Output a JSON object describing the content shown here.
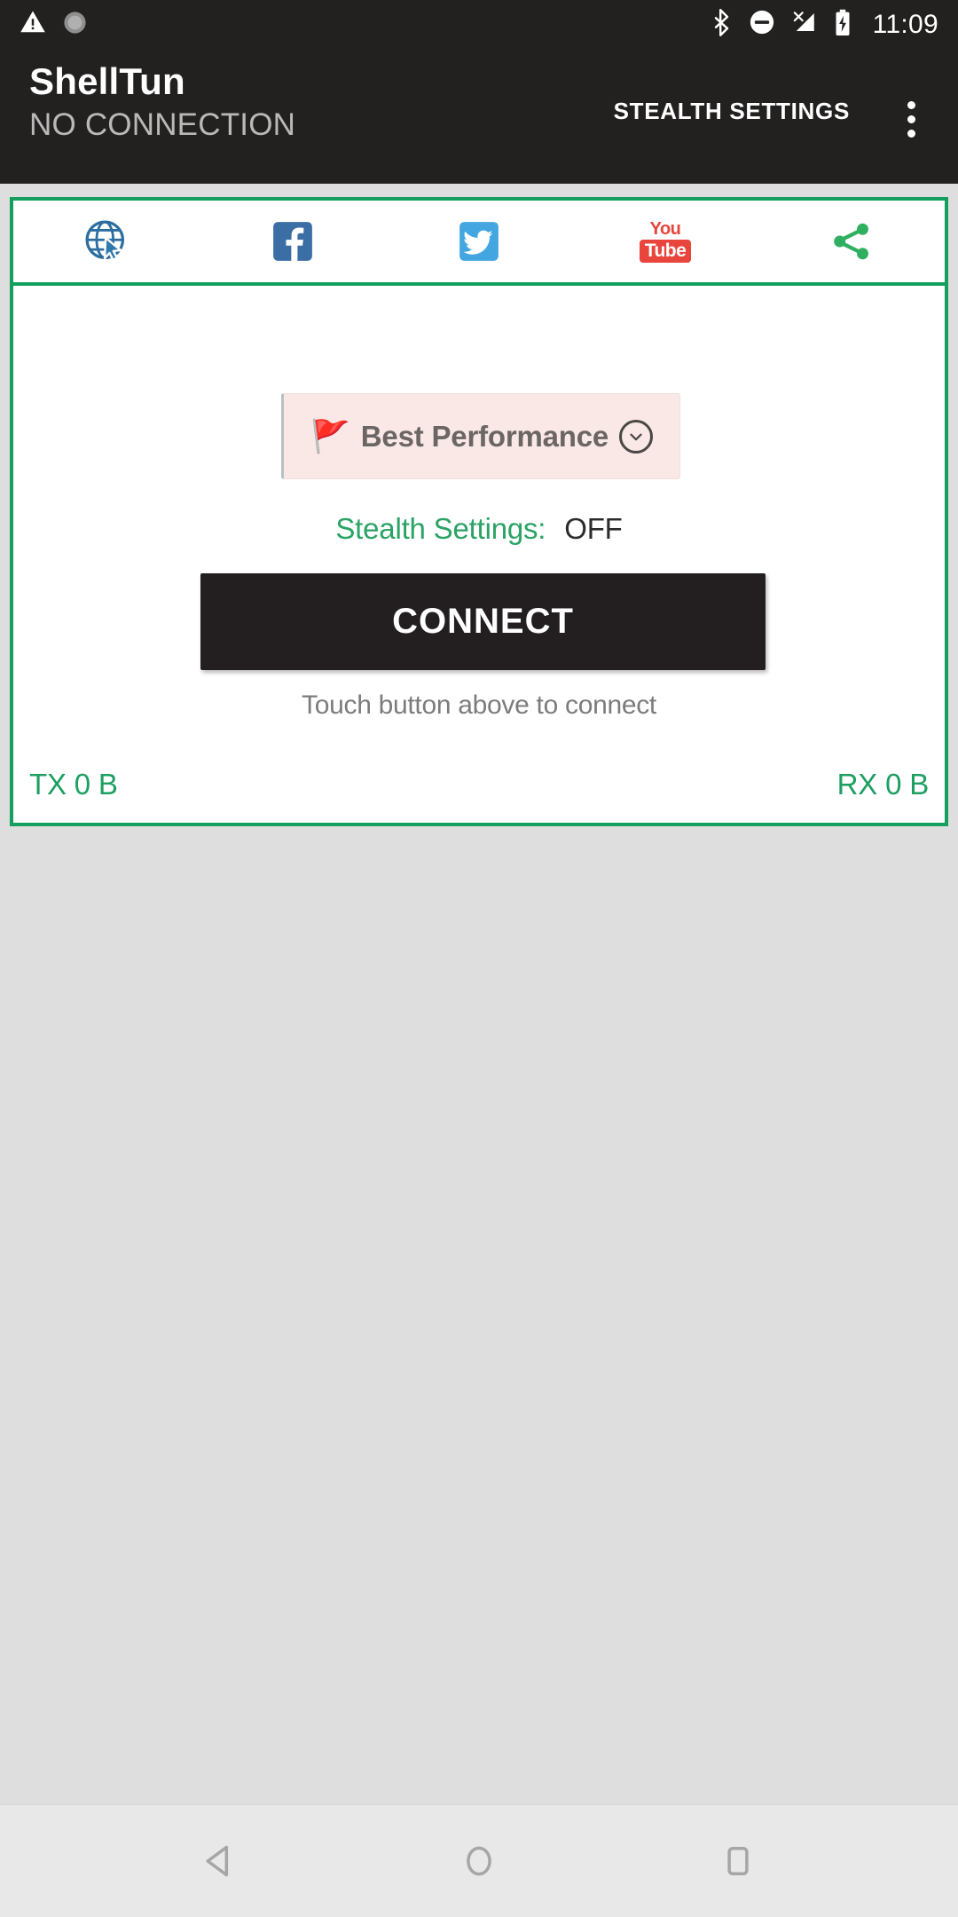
{
  "status_bar": {
    "left_icons": [
      {
        "name": "warning-triangle-icon"
      },
      {
        "name": "brightness-sync-icon"
      }
    ],
    "right_icons": [
      {
        "name": "bluetooth-icon"
      },
      {
        "name": "do-not-disturb-icon"
      },
      {
        "name": "no-signal-icon"
      },
      {
        "name": "battery-charging-icon"
      }
    ],
    "time": "11:09"
  },
  "app_bar": {
    "title": "ShellTun",
    "subtitle": "NO CONNECTION",
    "action_label": "STEALTH SETTINGS",
    "overflow_icon": "more-vertical-icon"
  },
  "social_row": [
    {
      "name": "globe-browser-icon",
      "label": "Browser"
    },
    {
      "name": "facebook-icon",
      "label": "f"
    },
    {
      "name": "twitter-icon",
      "label": "Twitter"
    },
    {
      "name": "youtube-icon",
      "you": "You",
      "tube": "Tube"
    },
    {
      "name": "share-icon",
      "label": "Share"
    }
  ],
  "main": {
    "performance": {
      "flag_icon": "waving-flag-icon",
      "label": "Best Performance",
      "chevron_icon": "chevron-down-icon"
    },
    "stealth": {
      "key": "Stealth Settings:",
      "value": "OFF"
    },
    "connect_button": "CONNECT",
    "connect_hint": "Touch button above to connect",
    "traffic": {
      "tx": "TX 0 B",
      "rx": "RX 0 B"
    }
  },
  "nav_bar": {
    "back": "back-icon",
    "home": "home-icon",
    "recents": "recents-icon"
  },
  "colors": {
    "accent_green": "#13a05e",
    "text_green": "#1d9f62",
    "header_dark": "#232020",
    "button_dark": "#231f20",
    "page_bg": "#dedede",
    "perf_bg": "#f9e8e5",
    "facebook_blue": "#3b6ea5",
    "twitter_blue": "#43a6e0",
    "youtube_red": "#e8453c"
  }
}
